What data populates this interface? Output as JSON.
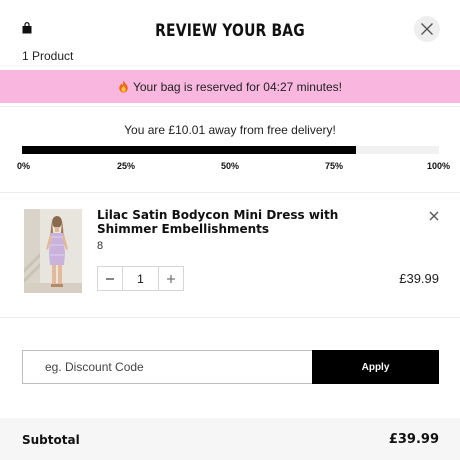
{
  "header": {
    "title": "REVIEW YOUR BAG",
    "product_count": "1 Product",
    "bag_icon": "shopping-bag-icon",
    "close_icon": "close-icon"
  },
  "reservation": {
    "text": "Your bag is reserved for 04:27 minutes!",
    "icon": "flame-icon",
    "background": "#f9b7e0"
  },
  "delivery": {
    "message": "You are £10.01 away from free delivery!",
    "progress_percent": 80,
    "ticks": [
      "0%",
      "25%",
      "50%",
      "75%",
      "100%"
    ]
  },
  "item": {
    "name": "Lilac Satin Bodycon Mini Dress with Shimmer Embellishments",
    "size": "8",
    "quantity": "1",
    "price": "£39.99",
    "decrement_icon": "minus-icon",
    "increment_icon": "plus-icon",
    "remove_icon": "close-icon"
  },
  "discount": {
    "placeholder": "eg. Discount Code",
    "apply_label": "Apply"
  },
  "summary": {
    "subtotal_label": "Subtotal",
    "subtotal_value": "£39.99"
  }
}
